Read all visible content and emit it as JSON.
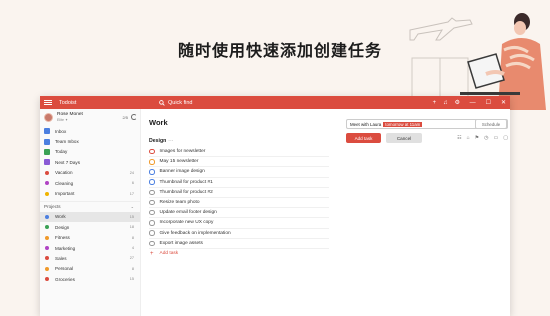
{
  "headline": "随时使用快速添加创建任务",
  "colors": {
    "brand": "#db4c3f",
    "background": "#faf4ef"
  },
  "titlebar": {
    "app_name": "Todoist",
    "search_placeholder": "Quick find",
    "icons": [
      "plus-icon",
      "bell-icon",
      "gear-icon"
    ],
    "window_buttons": [
      "—",
      "☐",
      "✕"
    ]
  },
  "user": {
    "name": "Rose Monet",
    "subtitle": "Elite ✦",
    "count": "2/5"
  },
  "nav": [
    {
      "label": "Inbox",
      "count": "",
      "icon": "inbox-icon",
      "color": "#4b7fe0"
    },
    {
      "label": "Team Inbox",
      "count": "",
      "icon": "team-inbox-icon",
      "color": "#4b7fe0"
    },
    {
      "label": "Today",
      "count": "",
      "icon": "today-icon",
      "color": "#3aa155"
    },
    {
      "label": "Next 7 Days",
      "count": "",
      "icon": "calendar-icon",
      "color": "#8a5bd6"
    }
  ],
  "labels": [
    {
      "label": "Vacation",
      "count": "24",
      "color": "#db4c3f"
    },
    {
      "label": "Cleaning",
      "count": "6",
      "color": "#b044c4"
    },
    {
      "label": "Important",
      "count": "17",
      "color": "#f0b400"
    }
  ],
  "projects_header": "Projects",
  "projects": [
    {
      "label": "Work",
      "count": "15",
      "color": "#4b7fe0",
      "active": true
    },
    {
      "label": "Design",
      "count": "18",
      "color": "#3aa155"
    },
    {
      "label": "Fitness",
      "count": "8",
      "color": "#f09a2b"
    },
    {
      "label": "Marketing",
      "count": "4",
      "color": "#b044c4"
    },
    {
      "label": "Sales",
      "count": "27",
      "color": "#db4c3f"
    },
    {
      "label": "Personal",
      "count": "8",
      "color": "#f09a2b"
    },
    {
      "label": "Groceries",
      "count": "15",
      "color": "#db4c3f"
    }
  ],
  "main": {
    "title": "Work",
    "section": "Design",
    "section_more": "⋯",
    "tasks": [
      {
        "label": "Images for newsletter",
        "priority": "red"
      },
      {
        "label": "May 15 newsletter",
        "priority": "orange"
      },
      {
        "label": "Banner image design",
        "priority": "blue"
      },
      {
        "label": "Thumbnail for product #1",
        "priority": "blue"
      },
      {
        "label": "Thumbnail for product #2",
        "priority": "none"
      },
      {
        "label": "Resize team photo",
        "priority": "none"
      },
      {
        "label": "Update email footer design",
        "priority": "none"
      },
      {
        "label": "Incorporate new UX copy",
        "priority": "none"
      },
      {
        "label": "Give feedback on implementation",
        "priority": "none"
      },
      {
        "label": "Export image assets",
        "priority": "none"
      }
    ],
    "add_task_label": "Add task"
  },
  "editor": {
    "text": "Meet with Laura",
    "highlight": "tomorrow at 11am",
    "schedule_label": "Schedule",
    "add_button": "Add task",
    "cancel_button": "Cancel",
    "icons": [
      "project-icon",
      "label-icon",
      "flag-icon",
      "reminder-icon",
      "comment-icon",
      "screen-icon"
    ]
  }
}
